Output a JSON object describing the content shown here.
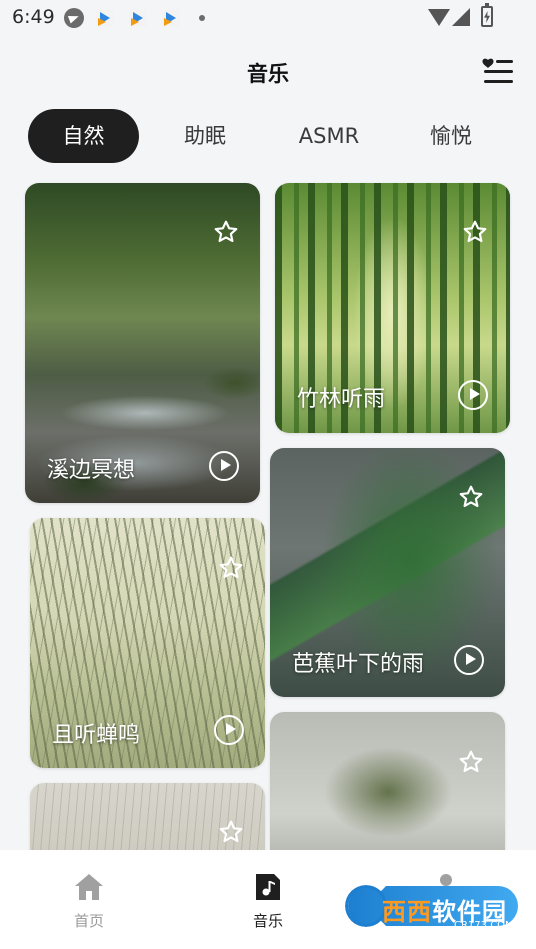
{
  "status_bar": {
    "time": "6:49",
    "icons": [
      "telegram-icon",
      "app-icon",
      "app-icon",
      "app-icon",
      "dot-icon",
      "wifi-icon",
      "signal-icon",
      "battery-charging-icon"
    ]
  },
  "header": {
    "title": "音乐",
    "playlist_icon": "playlist-heart-icon"
  },
  "tabs": [
    {
      "label": "自然",
      "active": true
    },
    {
      "label": "助眠",
      "active": false
    },
    {
      "label": "ASMR",
      "active": false
    },
    {
      "label": "愉悦",
      "active": false
    }
  ],
  "cards": [
    {
      "title": "溪边冥想"
    },
    {
      "title": "竹林听雨"
    },
    {
      "title": "芭蕉叶下的雨"
    },
    {
      "title": "且听蝉鸣"
    },
    {
      "title": ""
    },
    {
      "title": ""
    }
  ],
  "bottom_nav": [
    {
      "label": "首页",
      "icon": "home-icon",
      "active": false
    },
    {
      "label": "音乐",
      "icon": "music-note-icon",
      "active": true
    },
    {
      "label": "",
      "icon": "profile-icon",
      "active": false
    }
  ],
  "watermark": {
    "text_a": "西西",
    "text_b": "软件园",
    "sub": "CR173.COM"
  },
  "colors": {
    "background": "#f4f5f7",
    "tab_active_bg": "#1f1f1f",
    "nav_inactive": "#9a9a9a"
  }
}
